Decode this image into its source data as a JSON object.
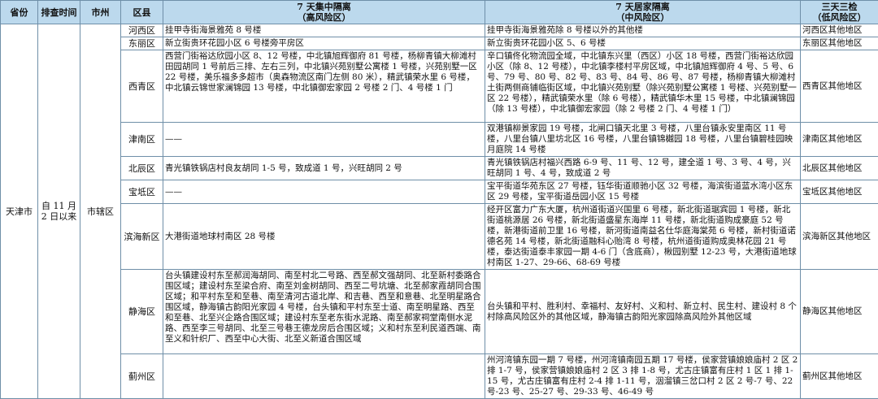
{
  "headers": {
    "province": "省份",
    "time": "排查时间",
    "city": "市州",
    "district": "区县",
    "col7_line1": "7 天集中隔离",
    "col7_line2": "（高风险区）",
    "home7_line1": "7 天居家隔离",
    "home7_line2": "（中风险区）",
    "test3_line1": "三天三检",
    "test3_line2": "（低风险区）"
  },
  "province": "天津市",
  "time": "自 11 月 2 日以来",
  "city": "市辖区",
  "rows": [
    {
      "district": "河西区",
      "high": "挂甲寺街海景雅苑 8 号楼",
      "mid": "挂甲寺街海景雅苑除 8 号楼以外的其他楼",
      "low": "河西区其他地区"
    },
    {
      "district": "东丽区",
      "high": "新立街贵环花园小区 6 号楼旁平房区",
      "mid": "新立街贵环花园小区 5、6 号楼",
      "low": "东丽区其他地区"
    },
    {
      "district": "西青区",
      "high": "西营门街裕达欣园小区 8、12 号楼，中北镇旭辉御府 81 号楼，杨柳青镇大柳滩村田园胡同 1 号前后三排、左右三列，中北镇兴苑别墅公寓楼 1 号楼，兴苑别墅一区 22 号楼，美乐福多多超市（奥森物流区南门左侧 80 米），精武镇荣水里 6 号楼，中北镇云锦世家澜锦园 13 号楼，中北镇御宏家园 2 号楼 2 门、4 号楼 1 门",
      "mid": "辛口镇佟化物流园全域，中北镇东兴里（西区）小区 18 号楼，西营门街裕达欣园小区（除 8、12 号楼），中北镇李楼村平房区域，中北镇旭辉御府 4 号、5 号、6 号、79 号、80 号、82 号、83 号、84 号、86 号、87 号楼，杨柳青镇大柳滩村土街两侧商铺临街区域，中北镇兴苑别墅（除兴苑别墅公寓楼 1 号楼、兴苑别墅一区 22 号楼），精武镇荣水里（除 6 号楼），精武镇华木里 15 号楼，中北镇澜锦园（除 13 号楼），中北镇御宏家园（除 2 号楼 2 门、4 号楼 1 门）",
      "low": "西青区其他地区"
    },
    {
      "district": "津南区",
      "high": "——",
      "mid": "双港镇柳景家园 19 号楼，北闸口镇天北里 3 号楼，八里台镇永安里南区 11 号楼，八里台镇八里坊北区 16 号楼，八里台镇锦樾园 18 号楼，八里台镇碧桂园映月庭院 14 号楼",
      "low": "津南区其他地区"
    },
    {
      "district": "北辰区",
      "high": "青光镇铁锅店村良友胡同 1-5 号，致成道 1 号，兴旺胡同 2 号",
      "mid": "青光镇铁锅店村福兴西路 6-9 号、11 号、12 号，建全道 1 号、3 号、4 号，兴旺胡同 1 号、4 号，致成道 2 号",
      "low": "北辰区其他地区"
    },
    {
      "district": "宝坻区",
      "high": "——",
      "mid": "宝平街道华苑东区 27 号楼，钰华街道顺驰小区 32 号楼，海滨街道蓝水湾小区东区 29 号楼，宝平街道岳园小区 15 号楼",
      "low": "宝坻区其他地区"
    },
    {
      "district": "滨海新区",
      "high": "大港街道地球村南区 28 号楼",
      "mid": "经开区富力广东大厦，杭州道街道兴国里 6 号楼，新北街道琚宾园 1 号楼，新北街道桃源居 26 号楼，新北街道盛星东海岸 11 号楼，新北街道购成豪庭 52 号楼，新港街道前卫里 16 号楼，新河街道南益名仕华庭海棠苑 6 号楼，新村街道诺德名苑 14 号楼，新北街道融科心贻湾 8 号楼，杭州道街道购成奥林花园 21 号楼，泰达街道泰丰家园一期 4-6 门（含底商），楸园别墅 12-23 号，大港街道地球村南区 1-27、29-66、68-69 号楼",
      "low": "滨海新区其他地区"
    },
    {
      "district": "静海区",
      "high": "台头镇建设村东至郝润海胡同、南至村北二号路、西至郝文强胡同、北至新村委路合围区域；建设村东至梁合府、南至刘金树胡同、西至二号坑塘、北至郝家霞胡同合围区域；和平村东至和至巷、南至清河古道北岸、和吉巷、西至和意巷、北至明星路合围区域，静海镇古韵阳光家园 4 号楼，台头镇和平村东至士道、南至明星路、西至和至巷、北至兴企路合围区域；建设村东至老东街水泥路、南至郝家祠堂南侧水泥路、西至李三号胡同、北至三号巷王德龙房后合围区域；义和村东至利民道西端、南至义和针织厂、西至中心大街、北至义新道合围区域",
      "mid": "台头镇和平村、胜利村、幸福村、友好村、义和村、新立村、民生村、建设村 8 个村除高风险区外的其他区域，静海镇古韵阳光家园除高风险外其他区域",
      "low": "静海区其他地区"
    },
    {
      "district": "蓟州区",
      "high": "",
      "mid": "州河湾镇东园一期 7 号楼，州河湾镇南园五期 17 号楼，侯家营镇娘娘庙村 2 区 2 排 1-7 号，侯家营镇娘娘庙村 2 区 3 排 1-8 号，尤古庄镇富有庄村 1 区 1 排 1-15 号，尤古庄镇富有庄村 2-4 排 1-11 号，洇溜镇三岔口村 2 区 2 号-7 号、22 号-23 号、25-27 号、29-33 号、46-49 号",
      "low": "蓟州区其他地区"
    }
  ]
}
